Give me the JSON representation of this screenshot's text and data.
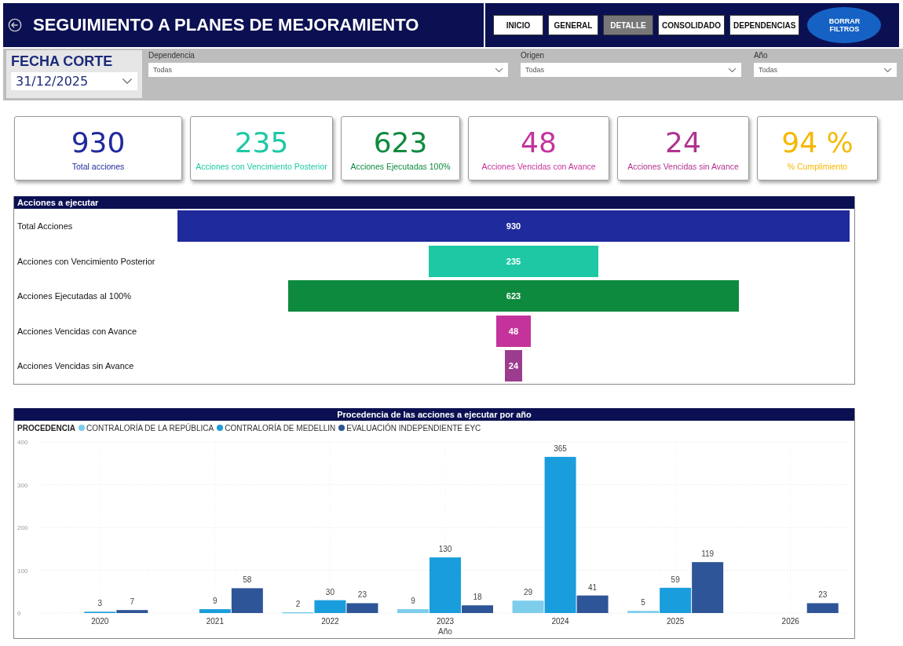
{
  "header": {
    "title": "SEGUIMIENTO A PLANES DE MEJORAMIENTO",
    "nav": [
      {
        "label": "INICIO",
        "selected": false,
        "kind": "tab"
      },
      {
        "label": "GENERAL",
        "selected": false,
        "kind": "tab"
      },
      {
        "label": "DETALLE",
        "selected": true,
        "kind": "tab"
      },
      {
        "label": "CONSOLIDADO",
        "selected": false,
        "kind": "tab"
      },
      {
        "label": "DEPENDENCIAS",
        "selected": false,
        "kind": "tab"
      },
      {
        "label": "BORRAR FILTROS",
        "selected": false,
        "kind": "pill"
      }
    ]
  },
  "date_filter": {
    "label": "FECHA CORTE",
    "value": "31/12/2025"
  },
  "filters": [
    {
      "label": "Dependencia",
      "value": "Todas"
    },
    {
      "label": "Origen",
      "value": "Todas"
    },
    {
      "label": "Año",
      "value": "Todas"
    }
  ],
  "kpis": [
    {
      "value": "930",
      "label": "Total acciones",
      "color": "#1f2a9c"
    },
    {
      "value": "235",
      "label": "Acciones con Vencimiento Posterior",
      "color": "#1ec8a5"
    },
    {
      "value": "623",
      "label": "Acciones Ejecutadas 100%",
      "color": "#0e8a3e"
    },
    {
      "value": "48",
      "label": "Acciones Vencidas con Avance",
      "color": "#c4339c"
    },
    {
      "value": "24",
      "label": "Acciones Vencidas sin Avance",
      "color": "#b0338f"
    },
    {
      "value": "94 %",
      "label": "% Cumplimiento",
      "color": "#f5b800"
    }
  ],
  "funnel": {
    "title": "Acciones a ejecutar",
    "rows": [
      {
        "label": "Total Acciones",
        "value": "930",
        "color": "#1f2a9c"
      },
      {
        "label": "Acciones con Vencimiento Posterior",
        "value": "235",
        "color": "#1ec8a5"
      },
      {
        "label": "Acciones Ejecutadas al 100%",
        "value": "623",
        "color": "#0e8a3e"
      },
      {
        "label": "Acciones Vencidas con Avance",
        "value": "48",
        "color": "#c4339c"
      },
      {
        "label": "Acciones Vencidas sin Avance",
        "value": "24",
        "color": "#9c3c8e"
      }
    ]
  },
  "year_chart": {
    "legend_title": "PROCEDENCIA",
    "chart_data": {
      "type": "bar",
      "title": "Procedencia de las acciones a ejecutar por año",
      "xlabel": "Año",
      "categories": [
        "2020",
        "2021",
        "2022",
        "2023",
        "2024",
        "2025",
        "2026"
      ],
      "series": [
        {
          "name": "CONTRALORÍA DE LA REPÚBLICA",
          "color": "#7ecdec",
          "values": [
            null,
            null,
            2,
            9,
            29,
            5,
            null
          ]
        },
        {
          "name": "CONTRALORÍA DE MEDELLIN",
          "color": "#1a9ddc",
          "values": [
            3,
            9,
            30,
            130,
            365,
            59,
            null
          ]
        },
        {
          "name": "EVALUACIÓN INDEPENDIENTE EYC",
          "color": "#2e5597",
          "values": [
            7,
            58,
            23,
            18,
            41,
            119,
            23
          ]
        }
      ],
      "grid": true,
      "ylim": [
        0,
        400
      ],
      "yticks": [
        0,
        100,
        200,
        300,
        400
      ],
      "data_labels": true
    }
  }
}
